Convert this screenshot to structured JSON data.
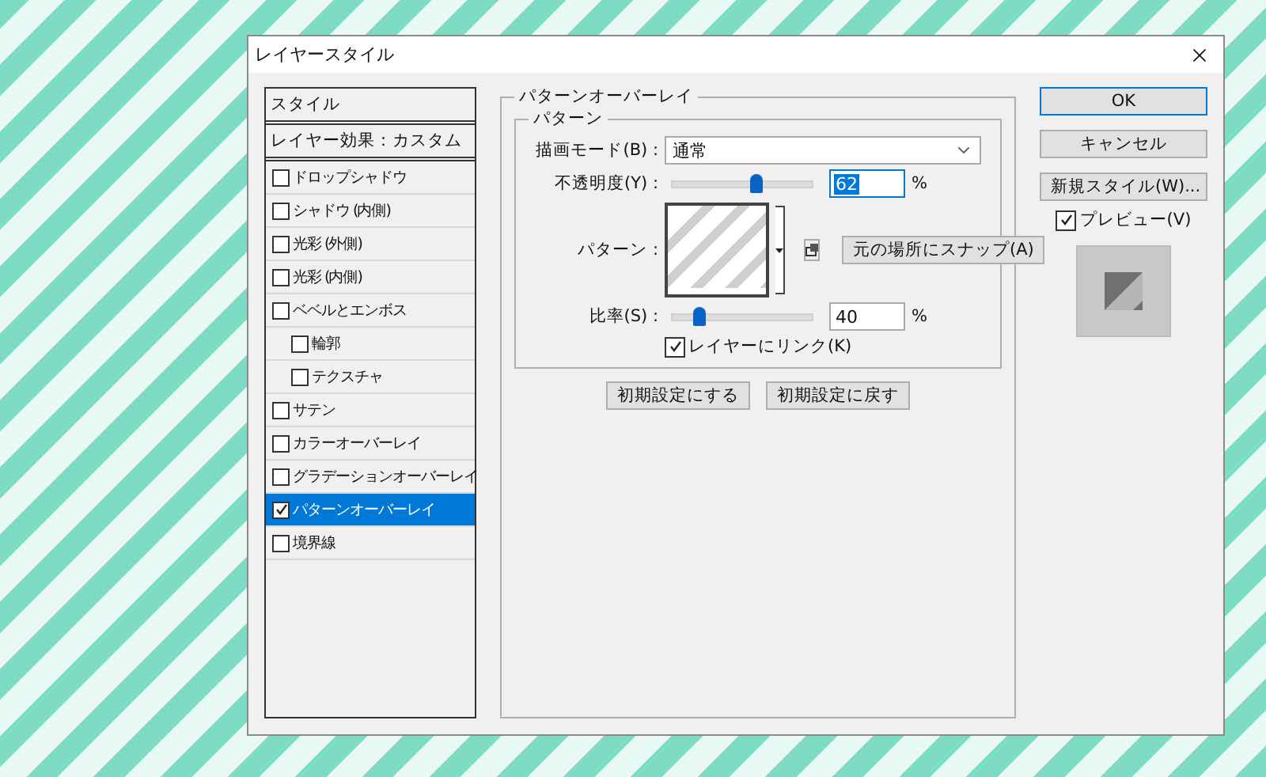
{
  "window": {
    "title": "レイヤースタイル"
  },
  "sidebar": {
    "header": "スタイル",
    "subheader": "レイヤー効果：カスタム",
    "items": [
      {
        "label": "ドロップシャドウ",
        "checked": false,
        "selected": false
      },
      {
        "label": "シャドウ (内側)",
        "checked": false,
        "selected": false
      },
      {
        "label": "光彩 (外側)",
        "checked": false,
        "selected": false
      },
      {
        "label": "光彩 (内側)",
        "checked": false,
        "selected": false
      },
      {
        "label": "ベベルとエンボス",
        "checked": false,
        "selected": false,
        "children": [
          {
            "label": "輪郭",
            "checked": false,
            "selected": false
          },
          {
            "label": "テクスチャ",
            "checked": false,
            "selected": false
          }
        ]
      },
      {
        "label": "サテン",
        "checked": false,
        "selected": false
      },
      {
        "label": "カラーオーバーレイ",
        "checked": false,
        "selected": false
      },
      {
        "label": "グラデーションオーバーレイ",
        "checked": false,
        "selected": false
      },
      {
        "label": "パターンオーバーレイ",
        "checked": true,
        "selected": true
      },
      {
        "label": "境界線",
        "checked": false,
        "selected": false
      }
    ]
  },
  "panel": {
    "title": "パターンオーバーレイ",
    "group_title": "パターン",
    "blend_mode": {
      "label": "描画モード(B) :",
      "value": "通常"
    },
    "opacity": {
      "label": "不透明度(Y) :",
      "level": 0.6,
      "value": "62",
      "value_selected": true,
      "unit": "%"
    },
    "pattern": {
      "label": "パターン :",
      "snap_button": "元の場所にスナップ(A)"
    },
    "scale": {
      "label": "比率(S) :",
      "level": 0.2,
      "value": "40",
      "value_selected": false,
      "unit": "%"
    },
    "link": {
      "label": "レイヤーにリンク(K)",
      "checked": true
    },
    "buttons": [
      "初期設定にする",
      "初期設定に戻す"
    ]
  },
  "actions": {
    "buttons": [
      {
        "label": "OK",
        "default": true
      },
      {
        "label": "キャンセル",
        "default": false
      },
      {
        "label": "新規スタイル(W)...",
        "default": false
      }
    ],
    "preview": {
      "label": "プレビュー(V)",
      "checked": true
    }
  }
}
